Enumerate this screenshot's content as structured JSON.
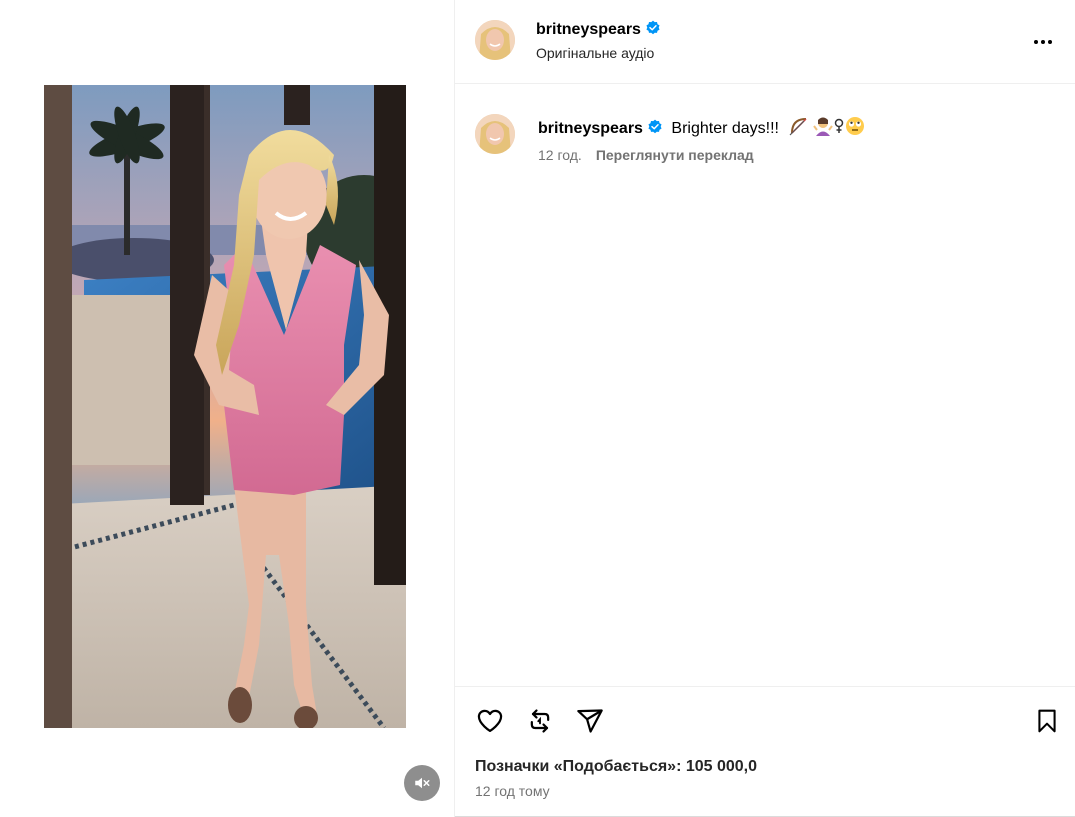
{
  "post": {
    "username": "britneyspears",
    "verified": true,
    "audio_label": "Оригінальне аудіо"
  },
  "caption": {
    "username": "britneyspears",
    "text": "Brighter days!!!",
    "age": "12 год.",
    "translate_label": "Переглянути переклад"
  },
  "engagement": {
    "likes_label": "Позначки «Подобається»: 105 000,0",
    "timestamp": "12 год тому"
  },
  "icons": {
    "verified": "verified-badge-icon",
    "more": "more-options-icon",
    "like": "heart-icon",
    "repost": "repost-icon",
    "share": "send-icon",
    "save": "bookmark-icon",
    "mute": "muted-speaker-icon"
  },
  "colors": {
    "verified_blue": "#0095f6",
    "secondary_text": "#737373",
    "divider": "#efefef"
  }
}
